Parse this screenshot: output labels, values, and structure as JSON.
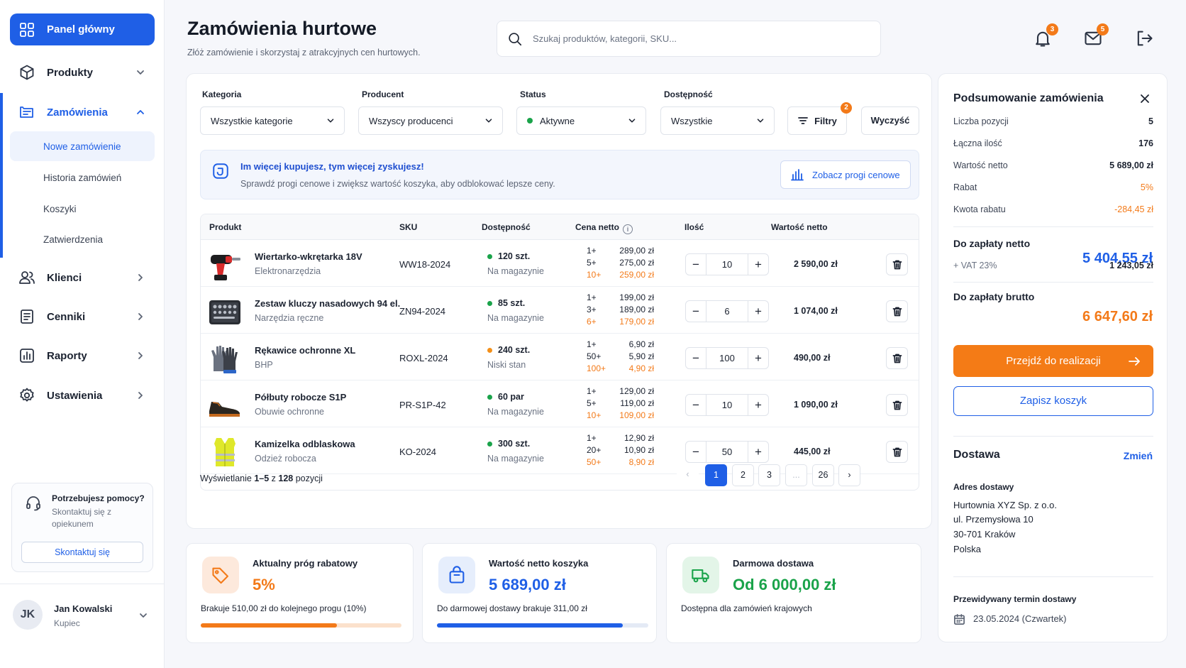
{
  "sidebar": {
    "items": [
      {
        "label": "Panel główny",
        "icon": "dashboard-icon"
      },
      {
        "label": "Produkty",
        "icon": "box-icon"
      },
      {
        "label": "Zamówienia",
        "icon": "orders-icon"
      },
      {
        "label": "Klienci",
        "icon": "users-icon"
      },
      {
        "label": "Cenniki",
        "icon": "pricelist-icon"
      },
      {
        "label": "Raporty",
        "icon": "reports-icon"
      },
      {
        "label": "Ustawienia",
        "icon": "settings-icon"
      }
    ],
    "orders_sub": [
      "Nowe zamówienie",
      "Historia zamówień",
      "Koszyki",
      "Zatwierdzenia"
    ],
    "help": {
      "title": "Potrzebujesz pomocy?",
      "text": "Skontaktuj się z opiekunem",
      "button": "Skontaktuj się"
    },
    "user": {
      "initials": "JK",
      "name": "Jan Kowalski",
      "role": "Kupiec"
    }
  },
  "header": {
    "title": "Zamówienia hurtowe",
    "subtitle": "Złóż zamówienie i skorzystaj z atrakcyjnych cen hurtowych.",
    "search_placeholder": "Szukaj produktów, kategorii, SKU...",
    "notifications_count": "3",
    "messages_count": "5"
  },
  "filters": {
    "category": {
      "label": "Kategoria",
      "value": "Wszystkie kategorie"
    },
    "producer": {
      "label": "Producent",
      "value": "Wszyscy producenci"
    },
    "status": {
      "label": "Status",
      "value": "Aktywne"
    },
    "availability": {
      "label": "Dostępność",
      "value": "Wszystkie"
    },
    "filters_button": "Filtry",
    "filters_count": "2",
    "clear_button": "Wyczyść"
  },
  "promo": {
    "title": "Im więcej kupujesz, tym więcej zyskujesz!",
    "text": "Sprawdź progi cenowe i zwiększ wartość koszyka, aby odblokować lepsze ceny.",
    "button": "Zobacz progi cenowe"
  },
  "table": {
    "columns": [
      "Produkt",
      "SKU",
      "Dostępność",
      "Cena netto",
      "Ilość",
      "Wartość netto"
    ],
    "rows": [
      {
        "name": "Wiertarko-wkrętarka 18V",
        "category": "Elektronarzędzia",
        "sku": "WW18-2024",
        "stock": "120 szt.",
        "status": "Na magazynie",
        "stock_color": "#1aa34a",
        "tiers": [
          {
            "q": "1+",
            "p": "289,00 zł"
          },
          {
            "q": "5+",
            "p": "275,00 zł"
          },
          {
            "q": "10+",
            "p": "259,00 zł"
          }
        ],
        "qty": "10",
        "value": "2 590,00 zł"
      },
      {
        "name": "Zestaw kluczy nasadowych 94 el.",
        "category": "Narzędzia ręczne",
        "sku": "ZN94-2024",
        "stock": "85 szt.",
        "status": "Na magazynie",
        "stock_color": "#1aa34a",
        "tiers": [
          {
            "q": "1+",
            "p": "199,00 zł"
          },
          {
            "q": "3+",
            "p": "189,00 zł"
          },
          {
            "q": "6+",
            "p": "179,00 zł"
          }
        ],
        "qty": "6",
        "value": "1 074,00 zł"
      },
      {
        "name": "Rękawice ochronne XL",
        "category": "BHP",
        "sku": "ROXL-2024",
        "stock": "240 szt.",
        "status": "Niski stan",
        "stock_color": "#f39019",
        "tiers": [
          {
            "q": "1+",
            "p": "6,90 zł"
          },
          {
            "q": "50+",
            "p": "5,90 zł"
          },
          {
            "q": "100+",
            "p": "4,90 zł"
          }
        ],
        "qty": "100",
        "value": "490,00 zł"
      },
      {
        "name": "Półbuty robocze S1P",
        "category": "Obuwie ochronne",
        "sku": "PR-S1P-42",
        "stock": "60 par",
        "status": "Na magazynie",
        "stock_color": "#1aa34a",
        "tiers": [
          {
            "q": "1+",
            "p": "129,00 zł"
          },
          {
            "q": "5+",
            "p": "119,00 zł"
          },
          {
            "q": "10+",
            "p": "109,00 zł"
          }
        ],
        "qty": "10",
        "value": "1 090,00 zł"
      },
      {
        "name": "Kamizelka odblaskowa",
        "category": "Odzież robocza",
        "sku": "KO-2024",
        "stock": "300 szt.",
        "status": "Na magazynie",
        "stock_color": "#1aa34a",
        "tiers": [
          {
            "q": "1+",
            "p": "12,90 zł"
          },
          {
            "q": "20+",
            "p": "10,90 zł"
          },
          {
            "q": "50+",
            "p": "8,90 zł"
          }
        ],
        "qty": "50",
        "value": "445,00 zł"
      }
    ]
  },
  "pagination": {
    "info_prefix": "Wyświetlanie ",
    "info_range": "1–5",
    "info_mid": " z ",
    "info_total": "128",
    "info_suffix": " pozycji",
    "pages": [
      "1",
      "2",
      "3",
      "...",
      "26"
    ],
    "prev": "‹",
    "next": "›"
  },
  "stats": [
    {
      "title": "Aktualny próg rabatowy",
      "value": "5%",
      "note": "Brakuje 510,00 zł do kolejnego progu (10%)",
      "progress": 0.68,
      "color": "#f37a19"
    },
    {
      "title": "Wartość netto koszyka",
      "value": "5 689,00 zł",
      "note": "Do darmowej dostawy brakuje 311,00 zł",
      "progress": 0.88,
      "color": "#1f5fe6"
    },
    {
      "title": "Darmowa dostawa",
      "value": "Od 6 000,00 zł",
      "note": "Dostępna dla zamówień krajowych",
      "color": "#1aa34a"
    }
  ],
  "summary": {
    "title": "Podsumowanie zamówienia",
    "rows": [
      {
        "label": "Liczba pozycji",
        "value": "5"
      },
      {
        "label": "Łączna ilość",
        "value": "176"
      },
      {
        "label": "Wartość netto",
        "value": "5 689,00 zł"
      },
      {
        "label": "Rabat",
        "value": "5%"
      },
      {
        "label": "Kwota rabatu",
        "value": "-284,45 zł"
      }
    ],
    "net_label": "Do zapłaty netto",
    "net_value": "5 404,55 zł",
    "vat_label": "+ VAT 23%",
    "vat_value": "1 243,05 zł",
    "gross_label": "Do zapłaty brutto",
    "gross_value": "6 647,60 zł",
    "checkout_button": "Przejdź do realizacji",
    "save_button": "Zapisz koszyk",
    "delivery_title": "Dostawa",
    "delivery_change": "Zmień",
    "address_label": "Adres dostawy",
    "address_lines": [
      "Hurtownia XYZ Sp. z o.o.",
      "ul. Przemysłowa 10",
      "30-701 Kraków",
      "Polska"
    ],
    "eta_label": "Przewidywany termin dostawy",
    "eta_value": "23.05.2024 (Czwartek)"
  },
  "colors": {
    "accent": "#1f5fe6",
    "orange": "#f37a19",
    "green": "#1aa34a"
  }
}
